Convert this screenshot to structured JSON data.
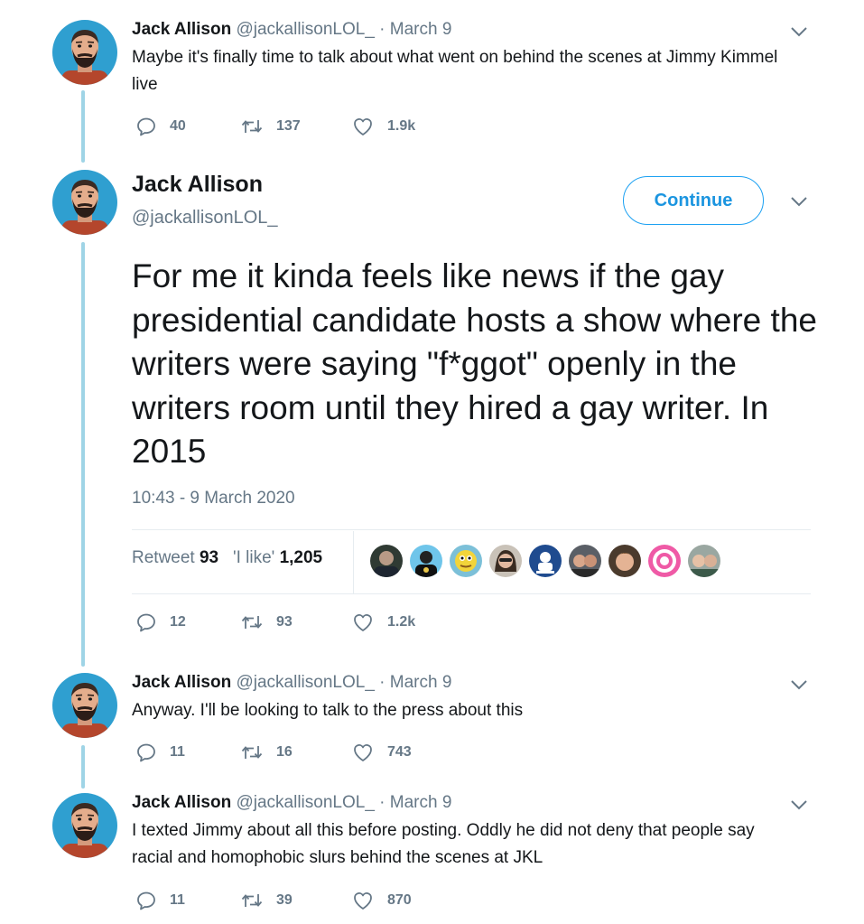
{
  "colors": {
    "accent": "#1da1f2",
    "thread_line": "#9fd4e6",
    "muted": "#657786",
    "text": "#14171a"
  },
  "tweets": [
    {
      "name": "Jack Allison",
      "handle": "@jackallisonLOL_",
      "dot": "·",
      "date": "March 9",
      "text": "Maybe it's finally time to talk about what went on behind the scenes at Jimmy Kimmel live",
      "replies": "40",
      "retweets": "137",
      "likes": "1.9k"
    },
    {
      "name": "Jack Allison",
      "handle": "@jackallisonLOL_",
      "dot": "·",
      "date": "March 9",
      "text": "Anyway. I'll be looking to talk to the press about this",
      "replies": "11",
      "retweets": "16",
      "likes": "743"
    },
    {
      "name": "Jack Allison",
      "handle": "@jackallisonLOL_",
      "dot": "·",
      "date": "March 9",
      "text": "I texted Jimmy about all this before posting. Oddly he did not deny that people say racial and homophobic slurs behind the scenes at JKL",
      "replies": "11",
      "retweets": "39",
      "likes": "870"
    }
  ],
  "main_tweet": {
    "name": "Jack Allison",
    "handle": "@jackallisonLOL_",
    "follow_label": "Continue",
    "text": "For me it kinda feels like news if the gay presidential candidate hosts a show where the writers were saying \"f*ggot\" openly in the writers room until they hired a gay writer. In 2015",
    "timestamp": "10:43 - 9 March 2020",
    "retweet_label": "Retweet",
    "retweet_count": "93",
    "like_label": "'I like'",
    "like_count": "1,205",
    "replies": "12",
    "retweets": "93",
    "likes": "1.2k"
  },
  "icons": {
    "reply": "reply-icon",
    "retweet": "retweet-icon",
    "like": "heart-icon",
    "menu": "chevron-down-icon"
  }
}
